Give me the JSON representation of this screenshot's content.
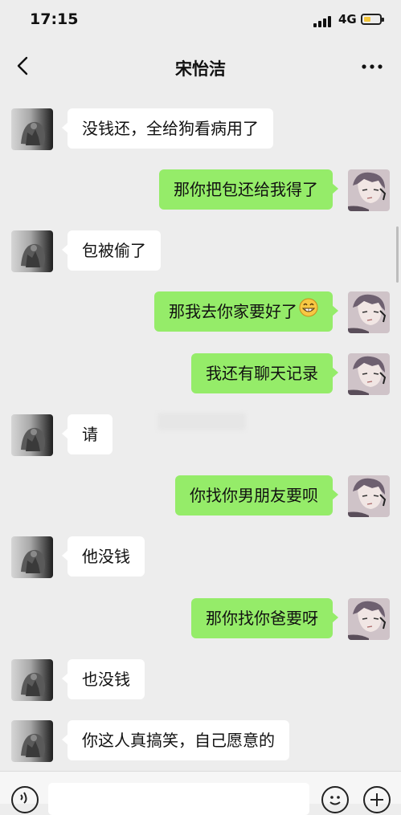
{
  "status_bar": {
    "time": "17:15",
    "network": "4G"
  },
  "header": {
    "title": "宋怡洁"
  },
  "messages": [
    {
      "side": "in",
      "text": "没钱还，全给狗看病用了"
    },
    {
      "side": "out",
      "text": "那你把包还给我得了"
    },
    {
      "side": "in",
      "text": "包被偷了"
    },
    {
      "side": "out",
      "text": "那我去你家要好了",
      "emoji": "grin-emoji"
    },
    {
      "side": "out",
      "text": "我还有聊天记录"
    },
    {
      "side": "in",
      "text": "请"
    },
    {
      "side": "out",
      "text": "你找你男朋友要呗"
    },
    {
      "side": "in",
      "text": "他没钱"
    },
    {
      "side": "out",
      "text": "那你找你爸要呀"
    },
    {
      "side": "in",
      "text": "也没钱"
    },
    {
      "side": "in",
      "text": "你这人真搞笑，自己愿意的"
    }
  ],
  "input_bar": {
    "voice_icon": "voice-icon",
    "emoji_icon": "emoji-icon",
    "plus_icon": "plus-icon"
  },
  "colors": {
    "background": "#ededed",
    "incoming_bubble": "#ffffff",
    "outgoing_bubble": "#95ec69",
    "battery": "#f3c63b"
  }
}
